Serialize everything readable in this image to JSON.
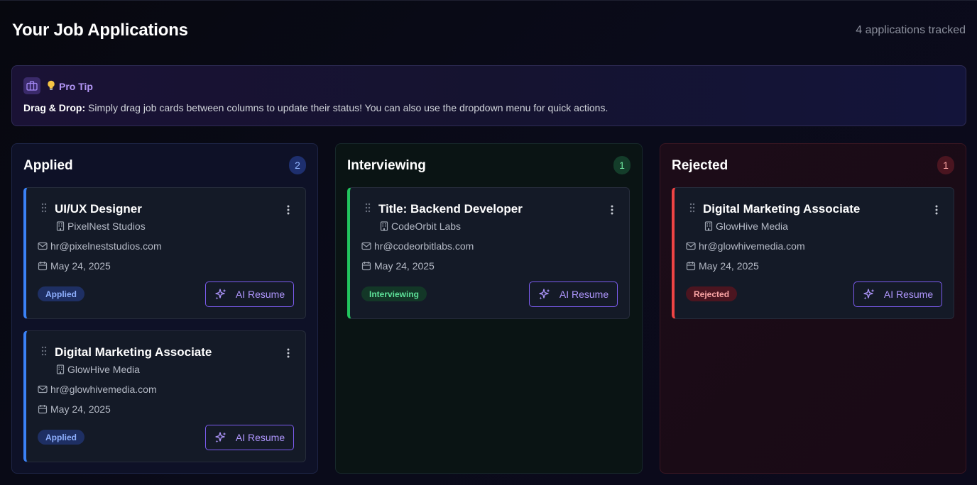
{
  "header": {
    "title": "Your Job Applications",
    "tracked": "4 applications tracked"
  },
  "tip": {
    "label": "Pro Tip",
    "bold": "Drag & Drop:",
    "text": " Simply drag job cards between columns to update their status! You can also use the dropdown menu for quick actions.",
    "icons": [
      "briefcase-icon",
      "lightbulb-icon"
    ]
  },
  "columns": [
    {
      "title": "Applied",
      "count": "2",
      "accent": "#3b82f6",
      "cards": [
        {
          "title": "UI/UX Designer",
          "company": "PixelNest Studios",
          "email": "hr@pixelneststudios.com",
          "date": "May 24, 2025",
          "status": "Applied",
          "action": "AI Resume"
        },
        {
          "title": "Digital Marketing Associate",
          "company": "GlowHive Media",
          "email": "hr@glowhivemedia.com",
          "date": "May 24, 2025",
          "status": "Applied",
          "action": "AI Resume"
        }
      ]
    },
    {
      "title": "Interviewing",
      "count": "1",
      "accent": "#22c55e",
      "cards": [
        {
          "title": "Title: Backend Developer",
          "company": "CodeOrbit Labs",
          "email": "hr@codeorbitlabs.com",
          "date": "May 24, 2025",
          "status": "Interviewing",
          "action": "AI Resume"
        }
      ]
    },
    {
      "title": "Rejected",
      "count": "1",
      "accent": "#ef4444",
      "cards": [
        {
          "title": "Digital Marketing Associate",
          "company": "GlowHive Media",
          "email": "hr@glowhivemedia.com",
          "date": "May 24, 2025",
          "status": "Rejected",
          "action": "AI Resume"
        }
      ]
    }
  ]
}
